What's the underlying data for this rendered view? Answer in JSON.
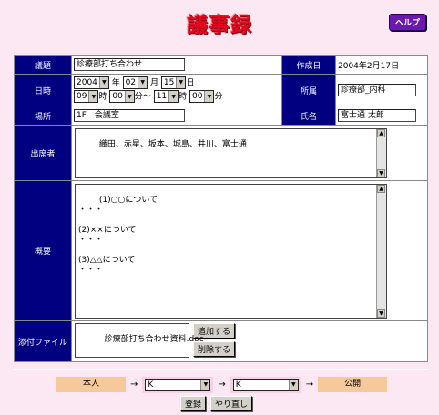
{
  "page": {
    "title": "議事録",
    "help_label": "ヘルプ"
  },
  "form": {
    "subject": {
      "label": "議題",
      "value": "診療部打ち合わせ"
    },
    "created": {
      "label": "作成日",
      "value": "2004年2月17日"
    },
    "datetime": {
      "label": "日時",
      "year": "2004",
      "month": "02",
      "day": "15",
      "start_hour": "09",
      "start_min": "00",
      "end_hour": "11",
      "end_min": "00",
      "unit_year": "年",
      "unit_month": "月",
      "unit_day": "日",
      "unit_hour": "時",
      "unit_min_range": "分～",
      "unit_min": "分"
    },
    "department": {
      "label": "所属",
      "value": "診療部_内科"
    },
    "place": {
      "label": "場所",
      "value": "1F　会議室"
    },
    "name": {
      "label": "氏名",
      "value": "富士通 太郎"
    },
    "attendees": {
      "label": "出席者",
      "value": "織田、赤星、坂本、城島、井川、富士通"
    },
    "summary": {
      "label": "概要",
      "value": "(1)○○について\n・・・\n\n(2)××について\n・・・\n\n(3)△△について\n・・・"
    },
    "attachment": {
      "label": "添付ファイル",
      "file": "診療部打ち合わせ資料.doc",
      "add_label": "追加する",
      "delete_label": "削除する"
    }
  },
  "flow": {
    "step1": "本人",
    "approver1": "K",
    "approver2": "K",
    "final": "公開",
    "arrow": "→"
  },
  "actions": {
    "register_label": "登録",
    "redo_label": "やり直し"
  }
}
